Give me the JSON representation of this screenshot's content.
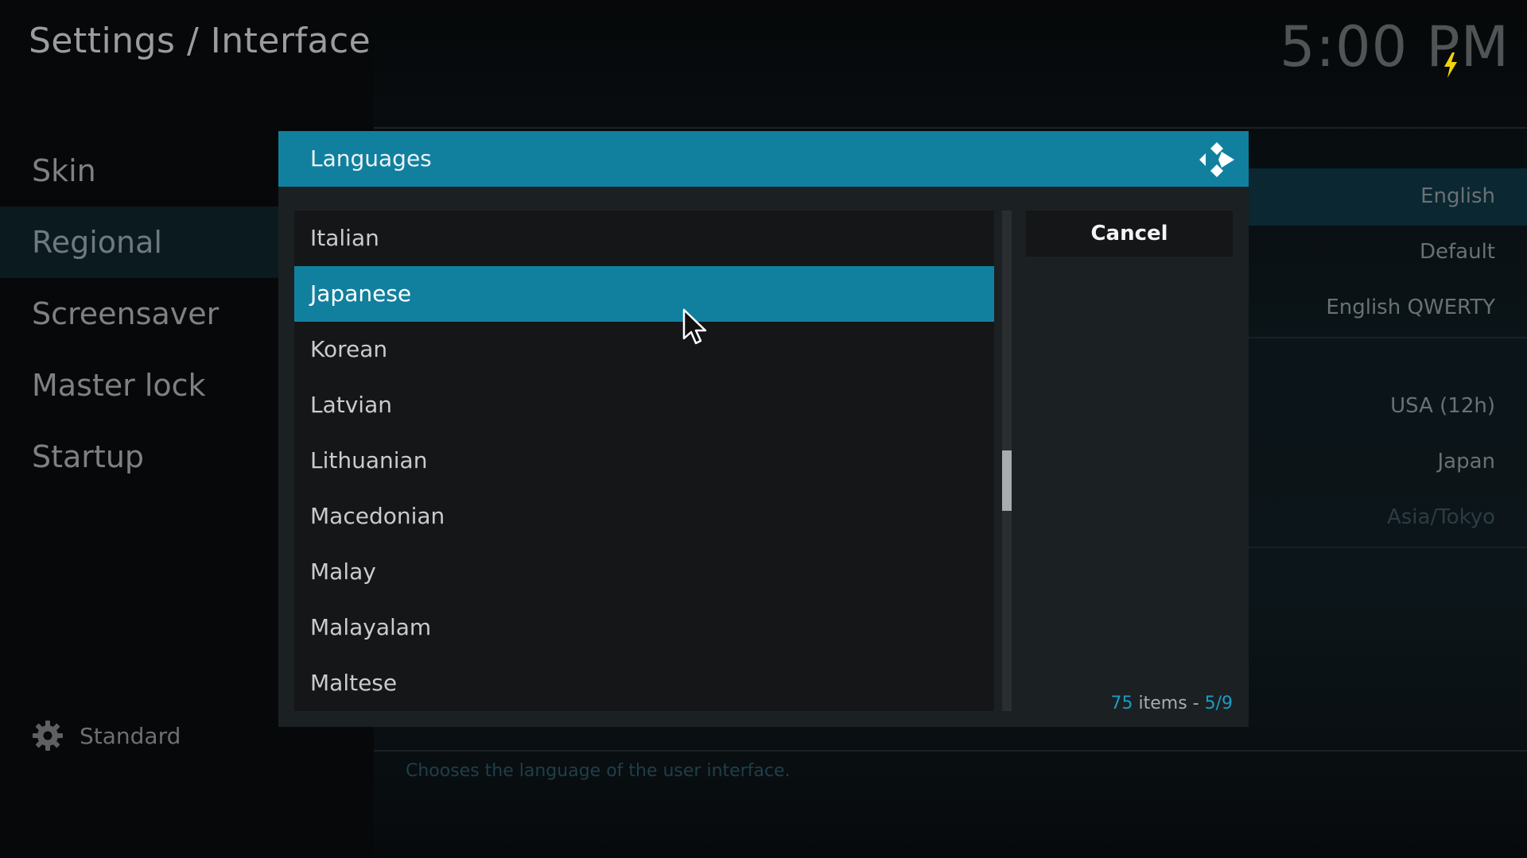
{
  "header": {
    "title": "Settings / Interface",
    "clock": "5:00 PM"
  },
  "sidebar": {
    "items": [
      {
        "label": "Skin",
        "active": false
      },
      {
        "label": "Regional",
        "active": true
      },
      {
        "label": "Screensaver",
        "active": false
      },
      {
        "label": "Master lock",
        "active": false
      },
      {
        "label": "Startup",
        "active": false
      }
    ],
    "footer_label": "Standard",
    "footer_icon": "gear-icon"
  },
  "settings_values": [
    "English",
    "Default",
    "English QWERTY",
    "USA (12h)",
    "Japan",
    "Asia/Tokyo"
  ],
  "description": "Chooses the language of the user interface.",
  "dialog": {
    "title": "Languages",
    "cancel_label": "Cancel",
    "items": [
      "Italian",
      "Japanese",
      "Korean",
      "Latvian",
      "Lithuanian",
      "Macedonian",
      "Malay",
      "Malayalam",
      "Maltese"
    ],
    "selected": "Japanese",
    "count_total": "75",
    "count_text": " items - ",
    "count_page": "5/9"
  },
  "colors": {
    "accent": "#11809f",
    "accent_text": "#1e9ac2",
    "bolt": "#f2d20c"
  }
}
